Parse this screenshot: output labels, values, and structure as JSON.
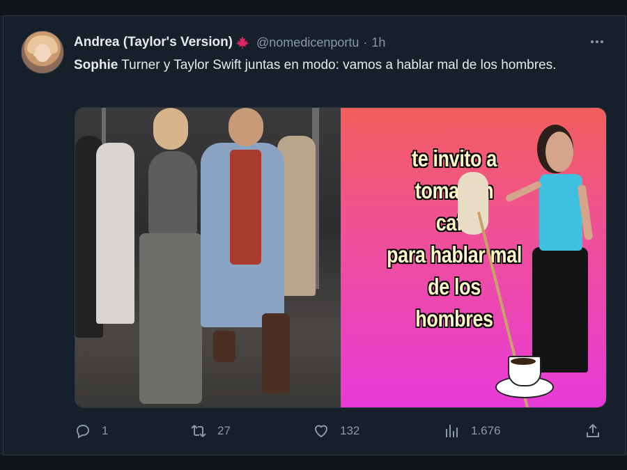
{
  "tweet": {
    "author_name": "Andrea (Taylor's Version)",
    "handle": "@nomedicenportu",
    "separator": "·",
    "time": "1h",
    "text_bold": "Sophie",
    "text_rest": " Turner y Taylor Swift juntas en modo: vamos a hablar mal de los hombres."
  },
  "meme": {
    "lines": [
      "te invito a",
      "tomar un",
      "café",
      "para hablar mal",
      "de los",
      "hombres"
    ]
  },
  "actions": {
    "replies": "1",
    "retweets": "27",
    "likes": "132",
    "views": "1.676"
  },
  "icons": {
    "author_badge": "maple-leaf-icon",
    "reply": "reply-icon",
    "retweet": "retweet-icon",
    "like": "heart-icon",
    "views": "views-icon",
    "share": "share-icon",
    "more": "more-icon"
  },
  "colors": {
    "background": "#15202b",
    "text": "#e7e9ea",
    "muted": "#8b98a5",
    "badge": "#e0245e"
  }
}
